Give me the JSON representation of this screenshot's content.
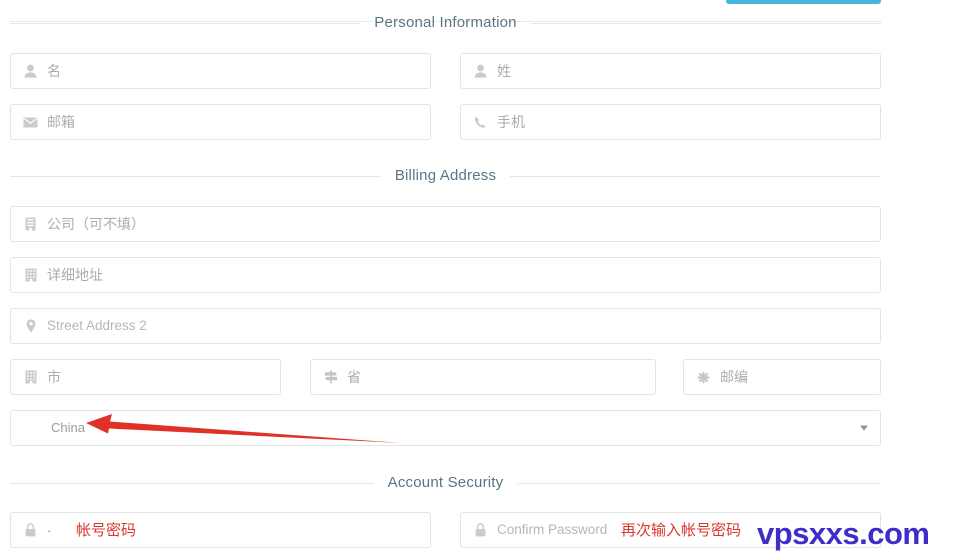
{
  "window": {
    "watermark": "vpsxxs.com"
  },
  "top_button": {
    "label": "",
    "color": "#4ab3dc"
  },
  "sections": [
    {
      "id": "personal-information",
      "title": "Personal Information"
    },
    {
      "id": "billing-address",
      "title": "Billing Address"
    },
    {
      "id": "account-security",
      "title": "Account Security"
    }
  ],
  "personal_information": {
    "first_name": {
      "placeholder": "名",
      "value": "",
      "icon": "user-icon"
    },
    "last_name": {
      "placeholder": "姓",
      "value": "",
      "icon": "user-icon"
    },
    "email": {
      "placeholder": "邮箱",
      "value": "",
      "icon": "envelope-icon"
    },
    "phone": {
      "placeholder": "手机",
      "value": "",
      "icon": "phone-icon"
    }
  },
  "billing_address": {
    "company": {
      "placeholder": "公司（可不填）",
      "value": "",
      "icon": "building-icon"
    },
    "address1": {
      "placeholder": "详细地址",
      "value": "",
      "icon": "building-icon"
    },
    "address2": {
      "placeholder": "Street Address 2",
      "value": "",
      "icon": "map-marker-icon"
    },
    "city": {
      "placeholder": "市",
      "value": "",
      "icon": "building-icon"
    },
    "state": {
      "placeholder": "省",
      "value": "",
      "icon": "map-signs-icon"
    },
    "postcode": {
      "placeholder": "邮编",
      "value": "",
      "icon": "asterisk-icon"
    },
    "country": {
      "value": "China",
      "icon": "chevron-down-icon"
    }
  },
  "account_security": {
    "password": {
      "placeholder": "",
      "value": "·",
      "icon": "lock-icon"
    },
    "confirm_password": {
      "placeholder": "Confirm Password",
      "value": "",
      "icon": "lock-icon"
    }
  },
  "annotations": {
    "country_arrow_color": "#e03127",
    "password_note": "帐号密码",
    "confirm_password_note": "再次输入帐号密码"
  }
}
